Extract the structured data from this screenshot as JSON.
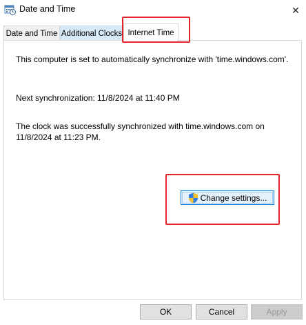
{
  "window": {
    "title": "Date and Time",
    "icon": "date-time-icon",
    "close_glyph": "✕"
  },
  "tabs": [
    {
      "label": "Date and Time"
    },
    {
      "label": "Additional Clocks"
    },
    {
      "label": "Internet Time",
      "active": true
    }
  ],
  "internet_time": {
    "sync_status": "This computer is set to automatically synchronize with 'time.windows.com'.",
    "next_sync": "Next synchronization: 11/8/2024 at 11:40 PM",
    "last_sync_line1": "The clock was successfully synchronized with time.windows.com on",
    "last_sync_line2": "11/8/2024 at 11:23 PM.",
    "change_settings_label": "Change settings..."
  },
  "footer": {
    "ok_label": "OK",
    "cancel_label": "Cancel",
    "apply_label": "Apply"
  },
  "colors": {
    "highlight": "#e5232b",
    "accent": "#0078d7"
  }
}
